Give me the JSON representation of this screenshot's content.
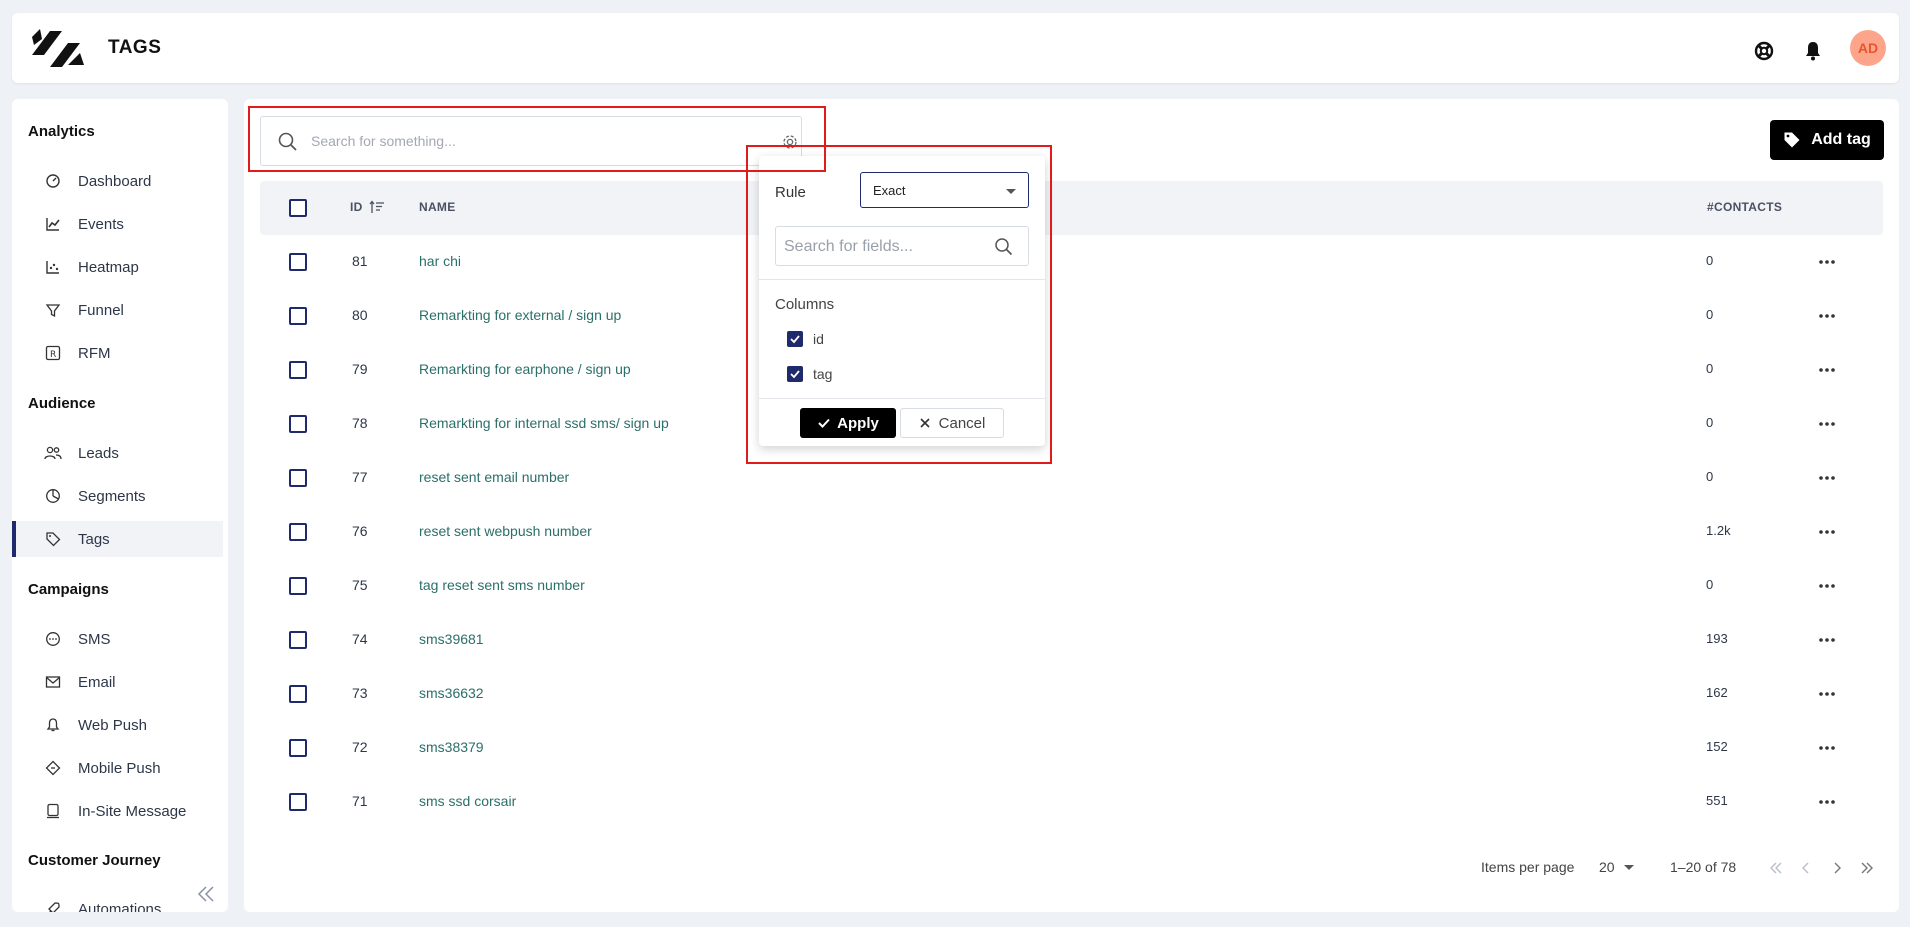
{
  "header": {
    "title": "TAGS",
    "avatar": "AD"
  },
  "sidebar": {
    "sections": [
      {
        "title": "Analytics",
        "items": [
          {
            "label": "Dashboard",
            "icon": "dashboard-icon"
          },
          {
            "label": "Events",
            "icon": "line-chart-icon"
          },
          {
            "label": "Heatmap",
            "icon": "scatter-icon"
          },
          {
            "label": "Funnel",
            "icon": "funnel-icon"
          },
          {
            "label": "RFM",
            "icon": "rfm-icon"
          }
        ]
      },
      {
        "title": "Audience",
        "items": [
          {
            "label": "Leads",
            "icon": "users-icon"
          },
          {
            "label": "Segments",
            "icon": "pie-chart-icon"
          },
          {
            "label": "Tags",
            "icon": "tag-icon",
            "active": true
          }
        ]
      },
      {
        "title": "Campaigns",
        "items": [
          {
            "label": "SMS",
            "icon": "chat-icon"
          },
          {
            "label": "Email",
            "icon": "mail-icon"
          },
          {
            "label": "Web Push",
            "icon": "bell-icon"
          },
          {
            "label": "Mobile Push",
            "icon": "mobile-push-icon"
          },
          {
            "label": "In-Site Message",
            "icon": "message-icon"
          }
        ]
      },
      {
        "title": "Customer Journey",
        "items": [
          {
            "label": "Automations",
            "icon": "rocket-icon"
          }
        ]
      }
    ]
  },
  "search": {
    "placeholder": "Search for something..."
  },
  "toolbar": {
    "add_label": "Add tag"
  },
  "table": {
    "headers": {
      "id": "ID",
      "name": "NAME",
      "contacts": "#CONTACTS"
    },
    "rows": [
      {
        "id": "81",
        "name": "har chi",
        "contacts": "0"
      },
      {
        "id": "80",
        "name": "Remarkting for external / sign up",
        "contacts": "0"
      },
      {
        "id": "79",
        "name": "Remarkting for earphone / sign up",
        "contacts": "0"
      },
      {
        "id": "78",
        "name": "Remarkting for internal ssd sms/ sign up",
        "contacts": "0"
      },
      {
        "id": "77",
        "name": "reset sent email number",
        "contacts": "0"
      },
      {
        "id": "76",
        "name": "reset sent webpush number",
        "contacts": "1.2k"
      },
      {
        "id": "75",
        "name": "tag reset sent sms number",
        "contacts": "0"
      },
      {
        "id": "74",
        "name": "sms39681",
        "contacts": "193"
      },
      {
        "id": "73",
        "name": "sms36632",
        "contacts": "162"
      },
      {
        "id": "72",
        "name": "sms38379",
        "contacts": "152"
      },
      {
        "id": "71",
        "name": "sms ssd corsair",
        "contacts": "551"
      }
    ]
  },
  "pagination": {
    "items_per_page_label": "Items per page",
    "items_per_page": "20",
    "range": "1–20 of 78"
  },
  "popup": {
    "rule_label": "Rule",
    "rule_value": "Exact",
    "field_search_placeholder": "Search for fields...",
    "columns_label": "Columns",
    "columns": [
      {
        "label": "id",
        "checked": true
      },
      {
        "label": "tag",
        "checked": true
      }
    ],
    "apply_label": "Apply",
    "cancel_label": "Cancel"
  },
  "colors": {
    "accent": "#1e2a6b",
    "link": "#2b6f6a",
    "annotation": "#e01b1b"
  }
}
